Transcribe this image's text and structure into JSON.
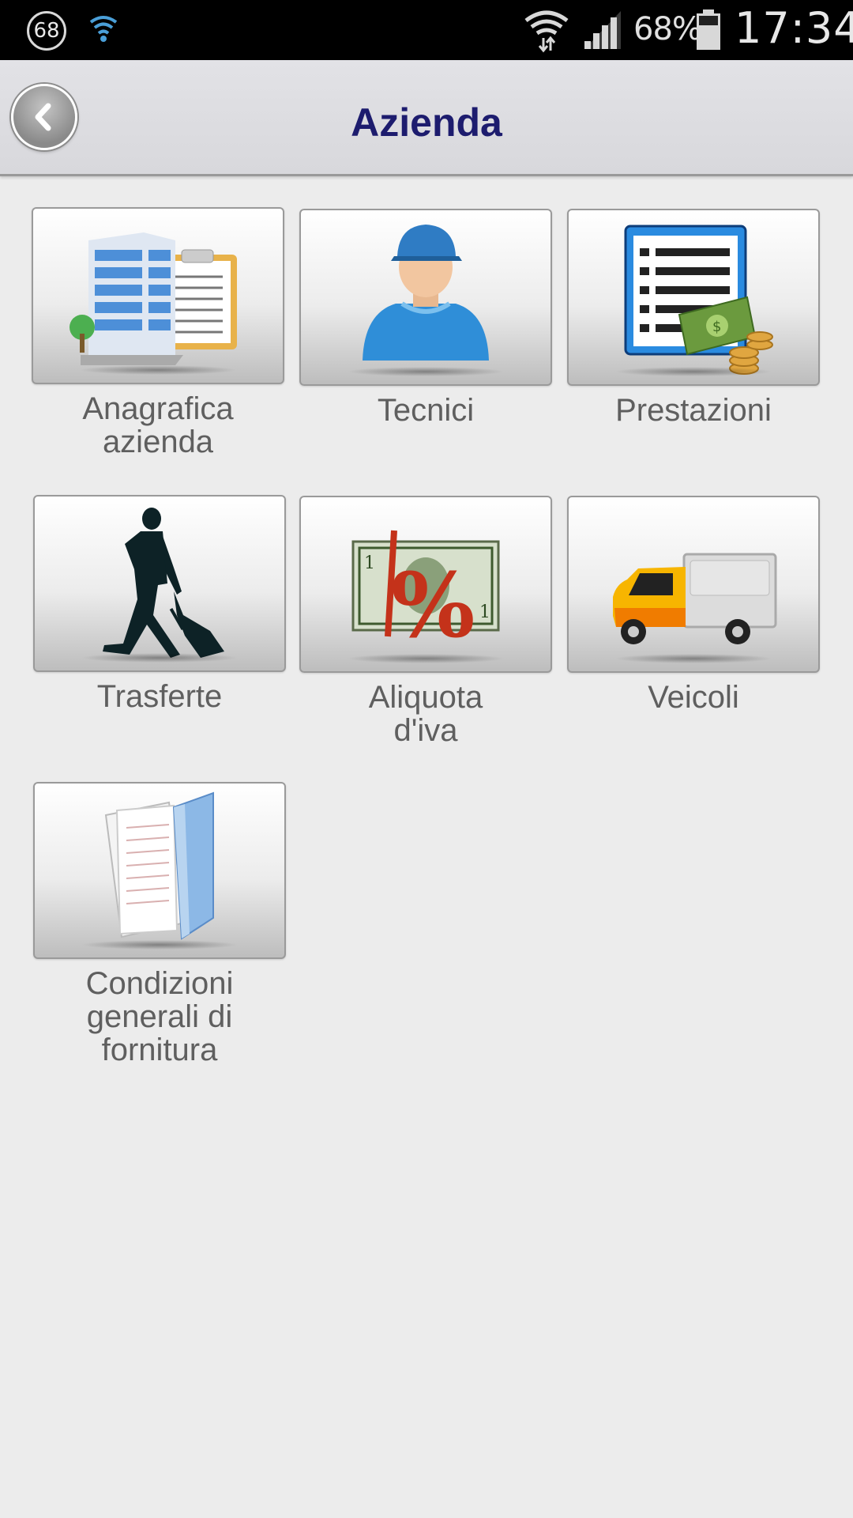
{
  "status_bar": {
    "notification_badge": "68",
    "battery_percent": "68%",
    "time": "17:34",
    "icons": [
      "notification-badge-icon",
      "wifi-icon",
      "wifi-signal-icon",
      "cell-signal-icon",
      "battery-icon"
    ]
  },
  "header": {
    "title": "Azienda",
    "back_icon": "chevron-left-icon"
  },
  "tiles": [
    {
      "label": "Anagrafica\nazienda",
      "icon": "office-building-clipboard-icon"
    },
    {
      "label": "Tecnici",
      "icon": "technician-person-icon"
    },
    {
      "label": "Prestazioni",
      "icon": "price-list-money-icon"
    },
    {
      "label": "Trasferte",
      "icon": "traveler-with-suitcase-icon"
    },
    {
      "label": "Aliquota\nd'iva",
      "icon": "banknote-percent-icon"
    },
    {
      "label": "Veicoli",
      "icon": "delivery-truck-icon"
    },
    {
      "label": "Condizioni\ngenerali di\nfornitura",
      "icon": "documents-folder-icon"
    }
  ],
  "colors": {
    "title": "#1d1c6e",
    "label": "#5f5f5f",
    "background": "#ececec"
  }
}
